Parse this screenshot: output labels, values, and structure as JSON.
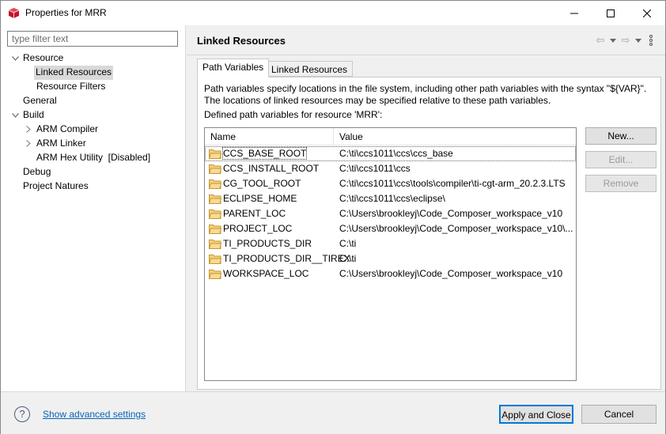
{
  "window": {
    "title": "Properties for MRR"
  },
  "sidebar": {
    "filter_placeholder": "type filter text",
    "items": [
      {
        "label": "Resource"
      },
      {
        "label": "Linked Resources"
      },
      {
        "label": "Resource Filters"
      },
      {
        "label": "General"
      },
      {
        "label": "Build"
      },
      {
        "label": "ARM Compiler"
      },
      {
        "label": "ARM Linker"
      },
      {
        "label": "ARM Hex Utility  [Disabled]"
      },
      {
        "label": "Debug"
      },
      {
        "label": "Project Natures"
      }
    ]
  },
  "main": {
    "title": "Linked Resources",
    "tabs": [
      {
        "label": "Path Variables"
      },
      {
        "label": "Linked Resources"
      }
    ],
    "description": "Path variables specify locations in the file system, including other path variables with the syntax \"${VAR}\". The locations of linked resources may be specified relative to these path variables.",
    "defined_label": "Defined path variables for resource 'MRR':",
    "table": {
      "headers": [
        "Name",
        "Value"
      ],
      "rows": [
        {
          "name": "CCS_BASE_ROOT",
          "value": "C:\\ti\\ccs1011\\ccs\\ccs_base"
        },
        {
          "name": "CCS_INSTALL_ROOT",
          "value": "C:\\ti\\ccs1011\\ccs"
        },
        {
          "name": "CG_TOOL_ROOT",
          "value": "C:\\ti\\ccs1011\\ccs\\tools\\compiler\\ti-cgt-arm_20.2.3.LTS"
        },
        {
          "name": "ECLIPSE_HOME",
          "value": "C:\\ti\\ccs1011\\ccs\\eclipse\\"
        },
        {
          "name": "PARENT_LOC",
          "value": "C:\\Users\\brookleyj\\Code_Composer_workspace_v10"
        },
        {
          "name": "PROJECT_LOC",
          "value": "C:\\Users\\brookleyj\\Code_Composer_workspace_v10\\..."
        },
        {
          "name": "TI_PRODUCTS_DIR",
          "value": "C:\\ti"
        },
        {
          "name": "TI_PRODUCTS_DIR__TIREX",
          "value": "C:\\ti"
        },
        {
          "name": "WORKSPACE_LOC",
          "value": "C:\\Users\\brookleyj\\Code_Composer_workspace_v10"
        }
      ]
    },
    "buttons": {
      "new": "New...",
      "edit": "Edit...",
      "remove": "Remove"
    }
  },
  "footer": {
    "help_icon": "?",
    "advanced_link": "Show advanced settings",
    "apply_close": "Apply and Close",
    "cancel": "Cancel"
  },
  "colors": {
    "accent": "#0078d7",
    "link": "#0b63b8",
    "folder": "#e8b64a"
  }
}
